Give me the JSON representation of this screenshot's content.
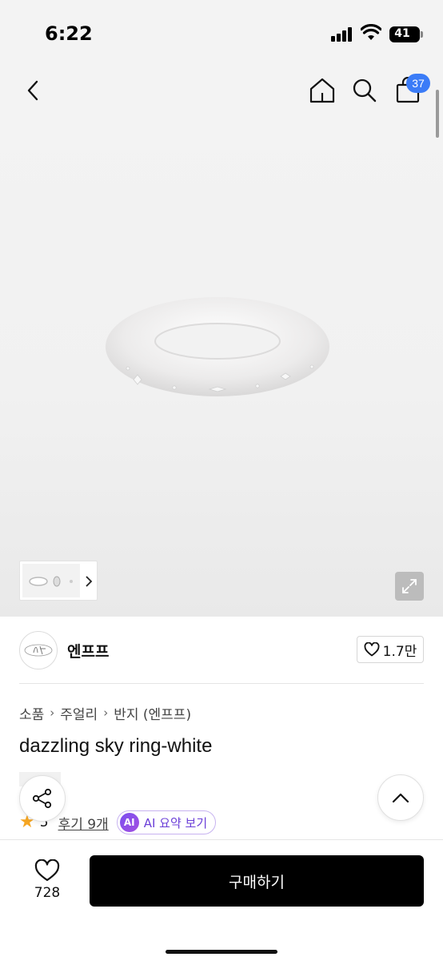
{
  "status_bar": {
    "time": "6:22",
    "battery": "41"
  },
  "nav": {
    "cart_count": "37",
    "back_icon": "chevron-left-icon",
    "home_icon": "home-icon",
    "search_icon": "search-icon",
    "cart_icon": "shopping-bag-icon"
  },
  "gallery": {
    "expand_icon": "expand-icon",
    "thumb_next_icon": "chevron-right-icon"
  },
  "shop": {
    "name": "엔프프",
    "likes": "1.7만"
  },
  "breadcrumb": [
    "소품",
    "주얼리",
    "반지 (엔프프)"
  ],
  "product": {
    "title": "dazzling sky ring-white",
    "rating": "5",
    "reviews_label": "후기 9개",
    "ai_badge": "AI",
    "ai_summary_label": "AI 요약 보기"
  },
  "bottom_bar": {
    "wishlist_count": "728",
    "buy_label": "구매하기"
  },
  "colors": {
    "accent_blue": "#3b7cf7",
    "star": "#f5a623",
    "ai_purple": "#6b3fd8",
    "buy_button": "#000000"
  }
}
